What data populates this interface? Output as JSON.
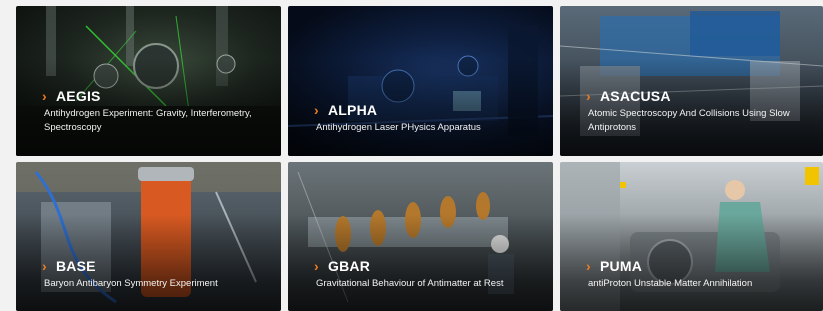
{
  "experiments": [
    {
      "name": "AEGIS",
      "description": "Antihydrogen Experiment: Gravity, Interferometry, Spectroscopy"
    },
    {
      "name": "ALPHA",
      "description": "Antihydrogen Laser PHysics Apparatus"
    },
    {
      "name": "ASACUSA",
      "description": "Atomic Spectroscopy And Collisions Using Slow Antiprotons"
    },
    {
      "name": "BASE",
      "description": "Baryon Antibaryon Symmetry Experiment"
    },
    {
      "name": "GBAR",
      "description": "Gravitational Behaviour of Antimatter at Rest"
    },
    {
      "name": "PUMA",
      "description": "antiProton Unstable Matter Annihilation"
    }
  ],
  "colors": {
    "accent": "#f07b1e"
  },
  "icons": {
    "chevron": "chevron-right-icon"
  }
}
